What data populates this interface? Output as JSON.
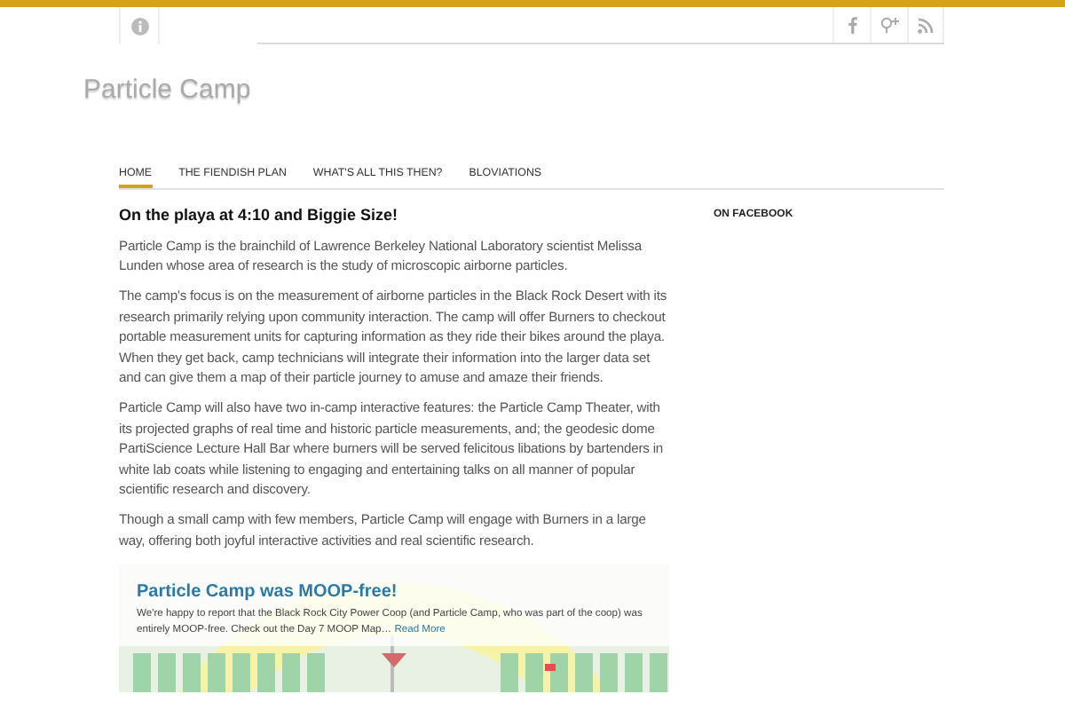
{
  "site": {
    "title": "Particle Camp"
  },
  "nav": [
    {
      "label": "HOME",
      "selected": true
    },
    {
      "label": "THE FIENDISH PLAN",
      "selected": false
    },
    {
      "label": "WHAT'S ALL THIS THEN?",
      "selected": false
    },
    {
      "label": "BLOVIATIONS",
      "selected": false
    }
  ],
  "post": {
    "title": "On the playa at 4:10 and Biggie Size!",
    "paragraphs": [
      "Particle Camp is the brainchild of Lawrence Berkeley National Laboratory scientist Melissa Lunden whose area of research is the study of microscopic airborne particles.",
      "The camp's focus is on the measurement of airborne particles in the Black Rock Desert with its research primarily relying upon community interaction. The camp will offer Burners to checkout portable measurement units for capturing information as they ride their bikes around the playa. When they get back, camp technicians will integrate their information into the larger data set and can give them a map of their particle journey to amuse and amaze their friends.",
      "Particle Camp will also have two in-camp interactive features: the Particle Camp Theater, with its projected graphs of real time and historic particle measurements, and; the geodesic dome PartiScience Lecture Hall Bar where burners will be served felicitous libations by bartenders in white lab coats while listening to engaging and entertaining talks on all manner of popular scientific research and discovery.",
      "Though a small camp with few members, Particle Camp will engage with Burners in a large way, offering both joyful interactive activities and real scientific research."
    ]
  },
  "feature": {
    "title": "Particle Camp was MOOP-free!",
    "excerpt": "We're happy to report that the Black Rock City Power Coop (and Particle Camp, who was part of the coop) was entirely MOOP-free.  Check out the Day 7 MOOP Map…",
    "link": "Read More"
  },
  "sidebar": {
    "heading": "ON FACEBOOK"
  }
}
